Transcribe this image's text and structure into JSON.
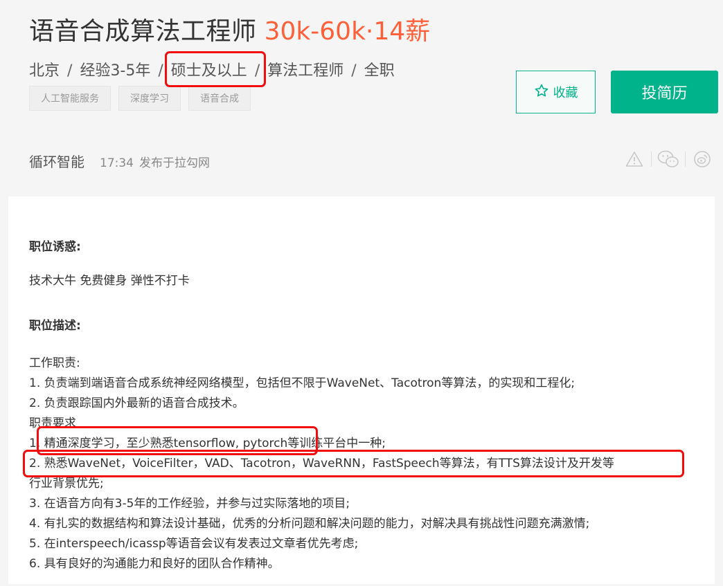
{
  "job": {
    "title": "语音合成算法工程师",
    "salary": "30k-60k·14薪",
    "city": "北京",
    "experience": "经验3-5年",
    "education": "硕士及以上",
    "category": "算法工程师",
    "type": "全职",
    "sep": "/"
  },
  "tags": [
    "人工智能服务",
    "深度学习",
    "语音合成"
  ],
  "actions": {
    "collect_label": "收藏",
    "apply_label": "投简历"
  },
  "publisher": {
    "company": "循环智能",
    "time": "17:34",
    "source": "发布于拉勾网"
  },
  "colors": {
    "accent": "#00b38a",
    "salary": "#fd5f39",
    "highlight": "#f20c0c"
  },
  "icons": [
    "star-icon",
    "warning-icon",
    "wechat-icon",
    "weibo-icon"
  ],
  "content": {
    "perks_title": "职位诱惑:",
    "perks": "技术大牛 免费健身 弹性不打卡",
    "desc_title": "职位描述:",
    "lines": [
      "工作职责:",
      "1. 负责端到端语音合成系统神经网络模型，包括但不限于WaveNet、Tacotron等算法，的实现和工程化;",
      "2. 负责跟踪国内外最新的语音合成技术。",
      "职责要求",
      "1. 精通深度学习，至少熟悉tensorflow, pytorch等训练平台中一种;",
      "2. 熟悉WaveNet，VoiceFilter，VAD、Tacotron，WaveRNN，FastSpeech等算法，有TTS算法设计及开发等",
      "行业背景优先;",
      "3. 在语音方向有3-5年的工作经验，并参与过实际落地的项目;",
      "4. 有扎实的数据结构和算法设计基础，优秀的分析问题和解决问题的能力，对解决具有挑战性问题充满激情;",
      "5. 在interspeech/icassp等语音会议有发表过文章者优先考虑;",
      "6. 具有良好的沟通能力和良好的团队合作精神。"
    ]
  }
}
